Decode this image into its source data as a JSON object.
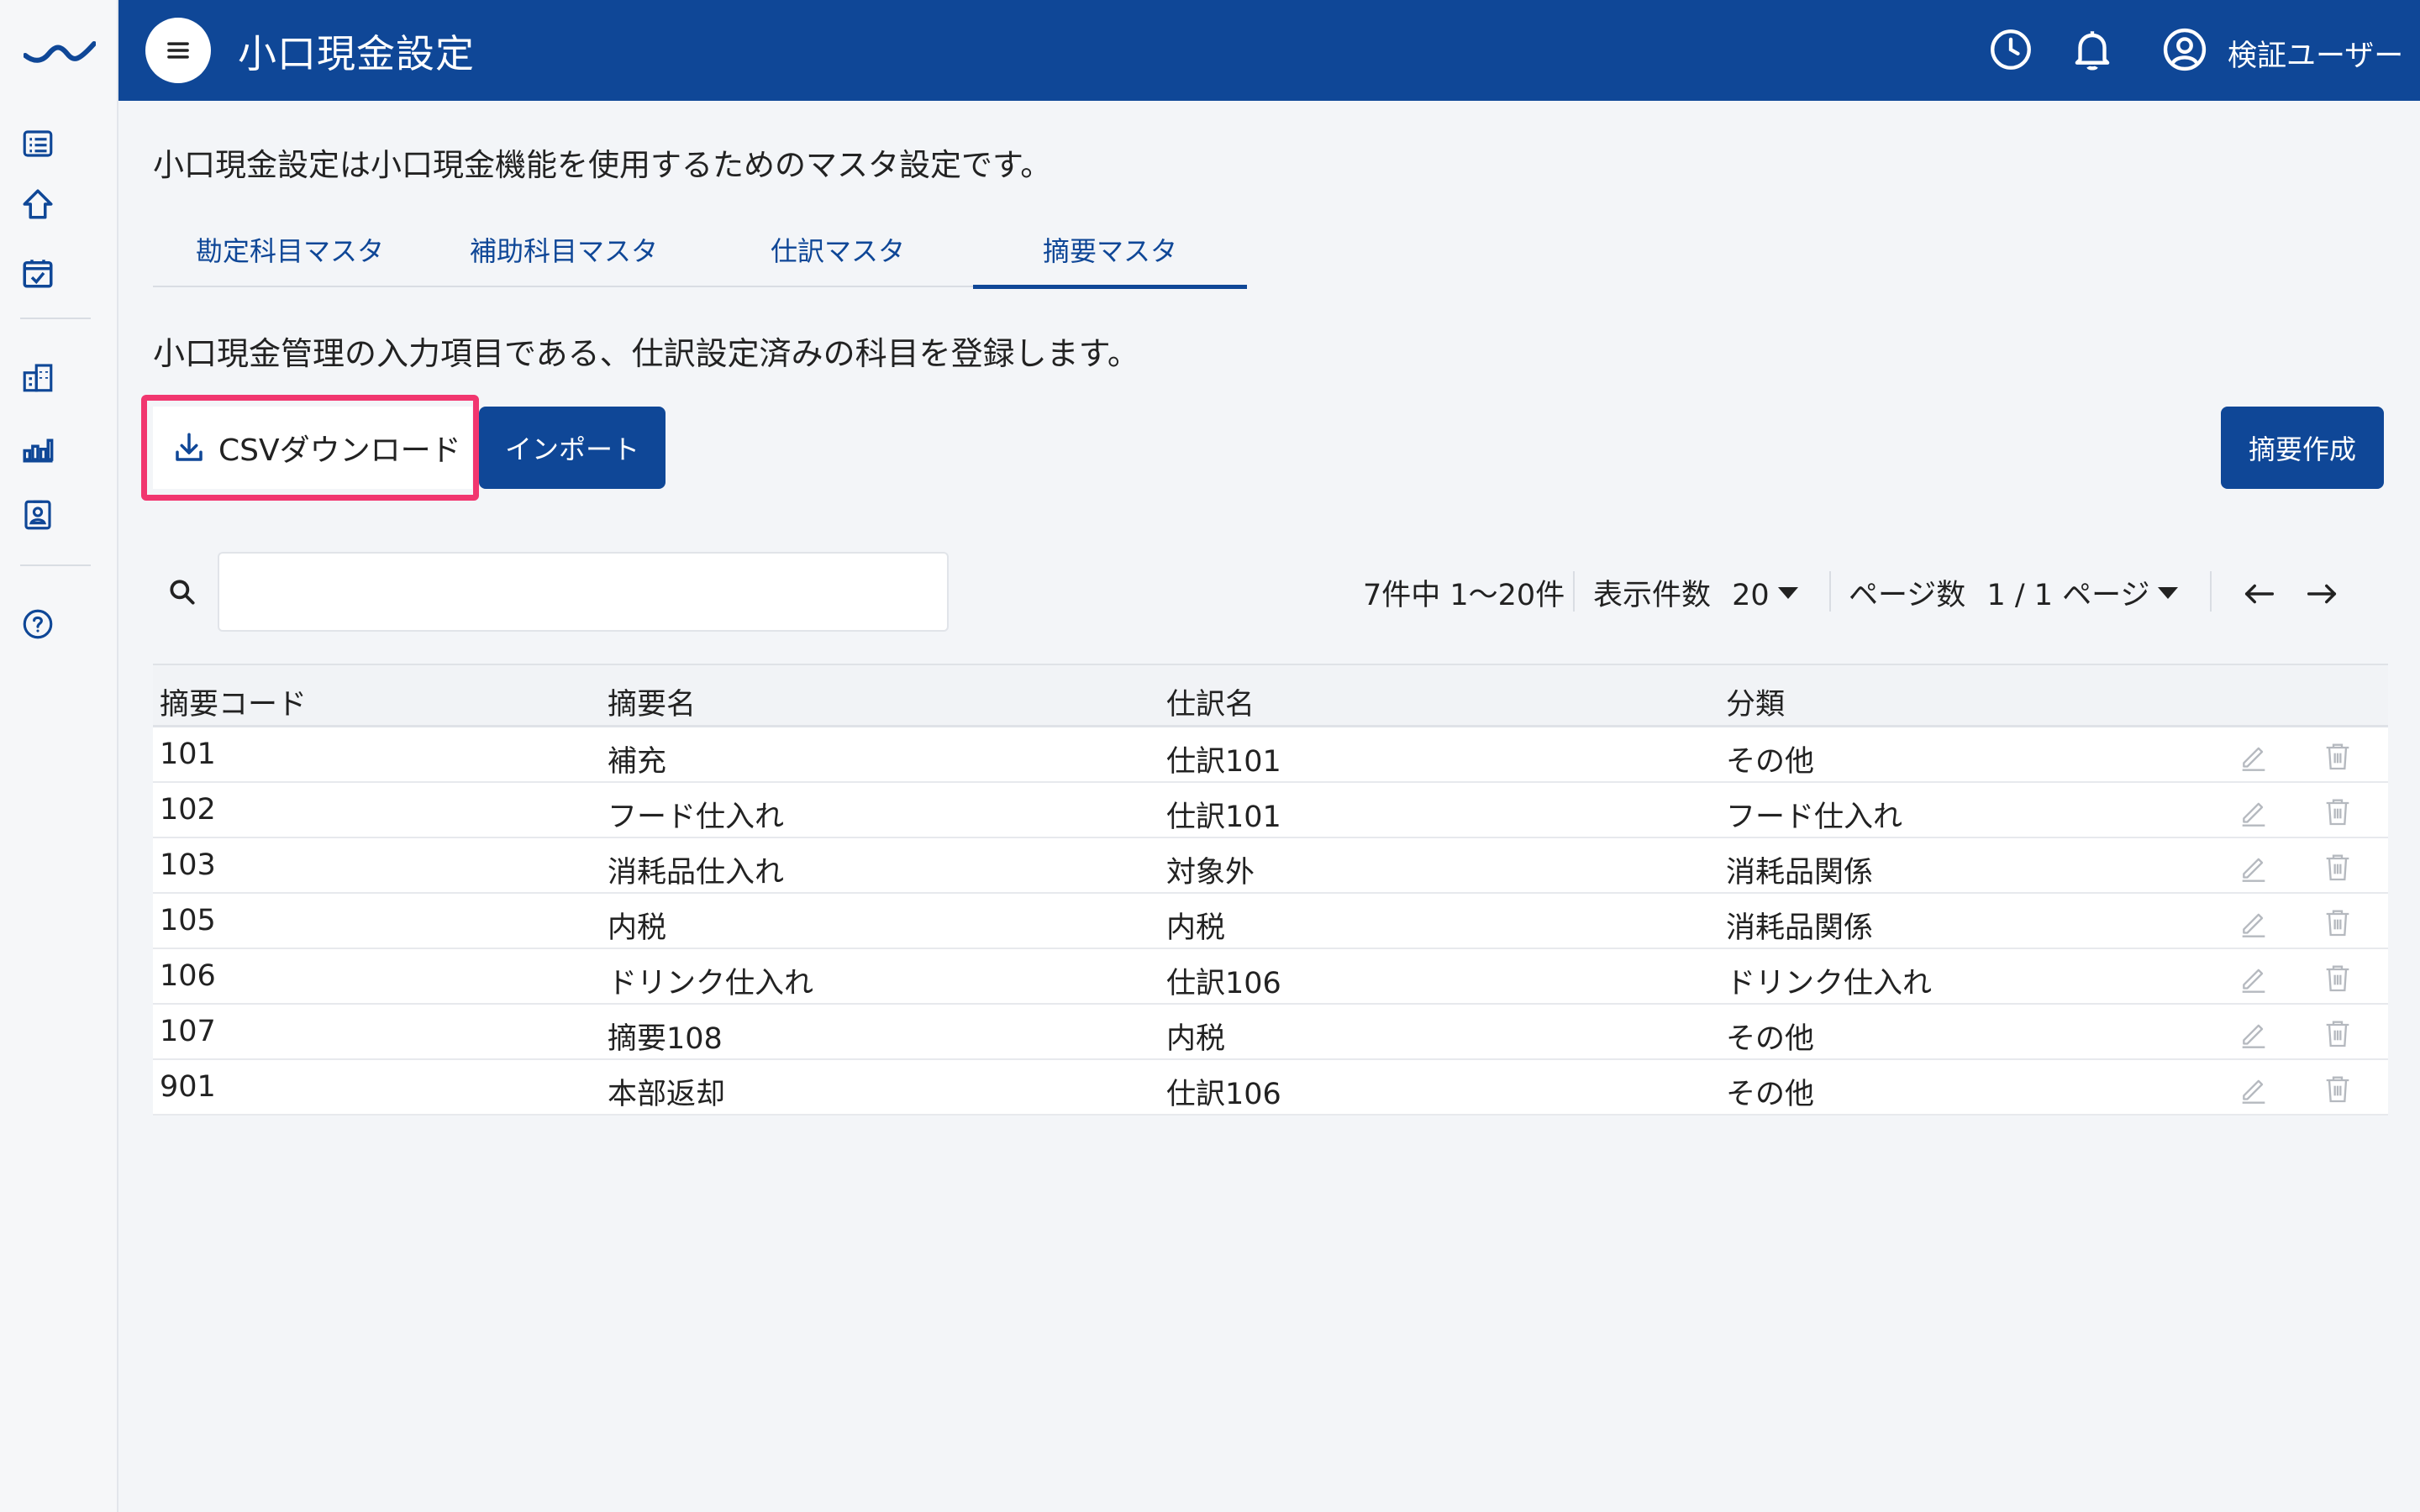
{
  "header": {
    "title": "小口現金設定",
    "user_name": "検証ユーザー"
  },
  "intro_text": "小口現金設定は小口現金機能を使用するためのマスタ設定です。",
  "tabs": [
    {
      "label": "勘定科目マスタ",
      "active": false
    },
    {
      "label": "補助科目マスタ",
      "active": false
    },
    {
      "label": "仕訳マスタ",
      "active": false
    },
    {
      "label": "摘要マスタ",
      "active": true
    }
  ],
  "subtitle": "小口現金管理の入力項目である、仕訳設定済みの科目を登録します。",
  "actions": {
    "csv_download": "CSVダウンロード",
    "import": "インポート",
    "create": "摘要作成"
  },
  "search": {
    "value": "",
    "placeholder": ""
  },
  "pagination": {
    "summary": "7件中 1〜20件",
    "per_page_label": "表示件数",
    "per_page_value": "20",
    "page_label": "ページ数",
    "page_value": "1 / 1 ページ"
  },
  "table": {
    "columns": [
      "摘要コード",
      "摘要名",
      "仕訳名",
      "分類"
    ],
    "rows": [
      [
        "101",
        "補充",
        "仕訳101",
        "その他"
      ],
      [
        "102",
        "フード仕入れ",
        "仕訳101",
        "フード仕入れ"
      ],
      [
        "103",
        "消耗品仕入れ",
        "対象外",
        "消耗品関係"
      ],
      [
        "105",
        "内税",
        "内税",
        "消耗品関係"
      ],
      [
        "106",
        "ドリンク仕入れ",
        "仕訳106",
        "ドリンク仕入れ"
      ],
      [
        "107",
        "摘要108",
        "内税",
        "その他"
      ],
      [
        "901",
        "本部返却",
        "仕訳106",
        "その他"
      ]
    ]
  },
  "colors": {
    "brand": "#0f4797",
    "highlight": "#f1366f"
  },
  "icons": {
    "sidebar": [
      "list-icon",
      "home-icon",
      "calendar-check-icon",
      "building-icon",
      "bar-chart-icon",
      "contact-card-icon",
      "help-icon"
    ],
    "header": [
      "menu-icon",
      "clock-icon",
      "bell-icon",
      "user-circle-icon"
    ],
    "row_actions": [
      "edit-icon",
      "trash-icon"
    ]
  }
}
